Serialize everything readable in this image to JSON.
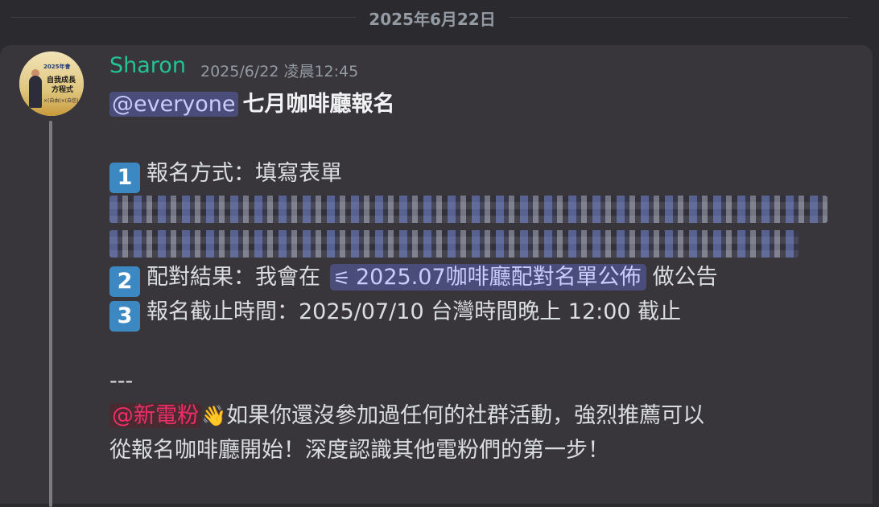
{
  "date_divider": "2025年6月22日",
  "message": {
    "author": "Sharon",
    "timestamp": "2025/6/22 凌晨12:45",
    "avatar": {
      "line1": "2025年會",
      "line2": "自我成長",
      "line3": "方程式",
      "line4": "×(自由)×(自信)"
    },
    "mention_everyone": "@everyone",
    "title": "七月咖啡廳報名",
    "items": [
      {
        "keycap": "1",
        "text": "報名方式：填寫表單"
      },
      {
        "keycap": "2",
        "text_before": "配對結果：我會在",
        "channel_icon": "announcement-channel-icon",
        "channel_glyph": "⚟",
        "channel_name": "2025.07咖啡廳配對名單公佈",
        "text_after": "做公告"
      },
      {
        "keycap": "3",
        "text": "報名截止時間：2025/07/10 台灣時間晚上 12:00 截止"
      }
    ],
    "separator": "---",
    "role_mention": "@新電粉",
    "wave_emoji": "👋",
    "body_line1": "如果你還沒參加過任何的社群活動，強烈推薦可以",
    "body_line2": "從報名咖啡廳開始！深度認識其他電粉們的第一步！"
  },
  "colors": {
    "username": "#22c497",
    "mention_bg": "#4a4c7a",
    "role_mention": "#ef2d6c",
    "keycap_bg": "#3b88c3"
  }
}
